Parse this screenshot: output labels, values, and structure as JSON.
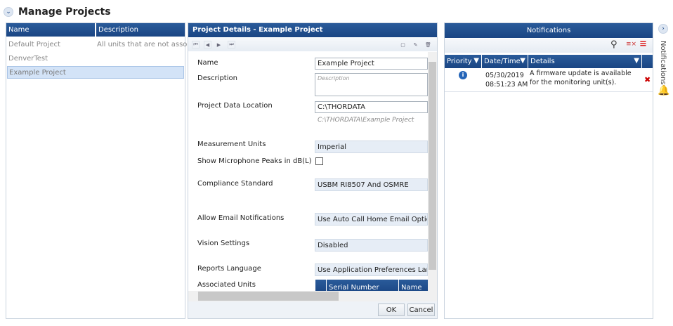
{
  "page": {
    "title": "Manage Projects"
  },
  "projects": {
    "columns": [
      "Name",
      "Description"
    ],
    "rows": [
      {
        "name": "Default Project",
        "description": "All units that are not associat"
      },
      {
        "name": "DenverTest",
        "description": ""
      },
      {
        "name": "Example Project",
        "description": ""
      }
    ],
    "selected": "Example Project"
  },
  "details": {
    "title": "Project Details - Example Project",
    "fields": {
      "name_label": "Name",
      "name_value": "Example Project",
      "description_label": "Description",
      "description_placeholder": "Description",
      "location_label": "Project Data Location",
      "location_value": "C:\\THORDATA",
      "location_path": "C:\\THORDATA\\Example Project",
      "units_label": "Measurement Units",
      "units_value": "Imperial",
      "mic_label": "Show Microphone Peaks in dB(L)",
      "compliance_label": "Compliance Standard",
      "compliance_value": "USBM RI8507 And OSMRE",
      "email_label": "Allow Email Notifications",
      "email_value": "Use Auto Call Home Email Options",
      "vision_label": "Vision Settings",
      "vision_value": "Disabled",
      "language_label": "Reports Language",
      "language_value": "Use Application Preferences Languag",
      "assoc_label": "Associated Units",
      "assoc_cols": [
        "Serial Number",
        "Name"
      ]
    },
    "ok": "OK",
    "cancel": "Cancel"
  },
  "notifications": {
    "title": "Notifications",
    "columns": [
      "Priority",
      "Date/Time",
      "Details"
    ],
    "rows": [
      {
        "priority": "info",
        "date": "05/30/2019",
        "time": "08:51:23 AM",
        "details": "A firmware update is available for the monitoring unit(s)."
      }
    ]
  },
  "sidebar": {
    "label": "Notifications"
  }
}
